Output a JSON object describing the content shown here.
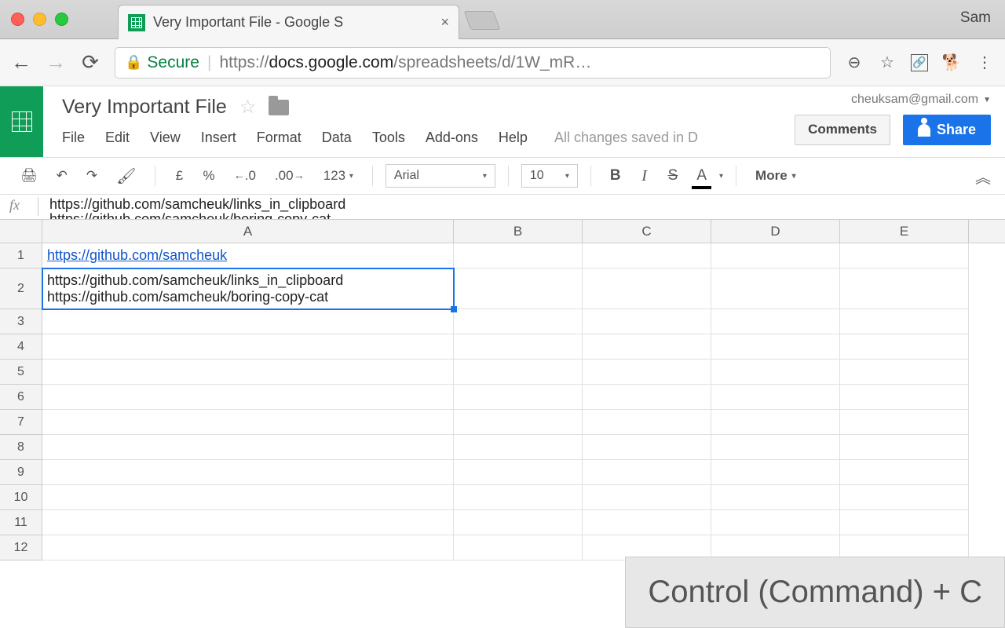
{
  "chrome": {
    "tab_title": "Very Important File - Google S",
    "user_name": "Sam",
    "secure_label": "Secure",
    "url_prefix": "https://",
    "url_host": "docs.google.com",
    "url_path": "/spreadsheets/d/1W_mR…"
  },
  "sheets": {
    "doc_title": "Very Important File",
    "user_email": "cheuksam@gmail.com",
    "comments_label": "Comments",
    "share_label": "Share",
    "menus": [
      "File",
      "Edit",
      "View",
      "Insert",
      "Format",
      "Data",
      "Tools",
      "Add-ons",
      "Help"
    ],
    "save_status": "All changes saved in D"
  },
  "toolbar": {
    "currency": "£",
    "percent": "%",
    "dec_dec": ".0",
    "inc_dec": ".00",
    "num_format": "123",
    "font_name": "Arial",
    "font_size": "10",
    "more_label": "More"
  },
  "formula": {
    "line1": "https://github.com/samcheuk/links_in_clipboard",
    "line2": "https://github.com/samcheuk/boring-copy-cat"
  },
  "grid": {
    "cols": [
      "A",
      "B",
      "C",
      "D",
      "E"
    ],
    "rows": [
      "1",
      "2",
      "3",
      "4",
      "5",
      "6",
      "7",
      "8",
      "9",
      "10",
      "11",
      "12"
    ],
    "a1": "https://github.com/samcheuk",
    "a2": "https://github.com/samcheuk/links_in_clipboard\nhttps://github.com/samcheuk/boring-copy-cat"
  },
  "overlay": {
    "text": "Control (Command) + C"
  }
}
